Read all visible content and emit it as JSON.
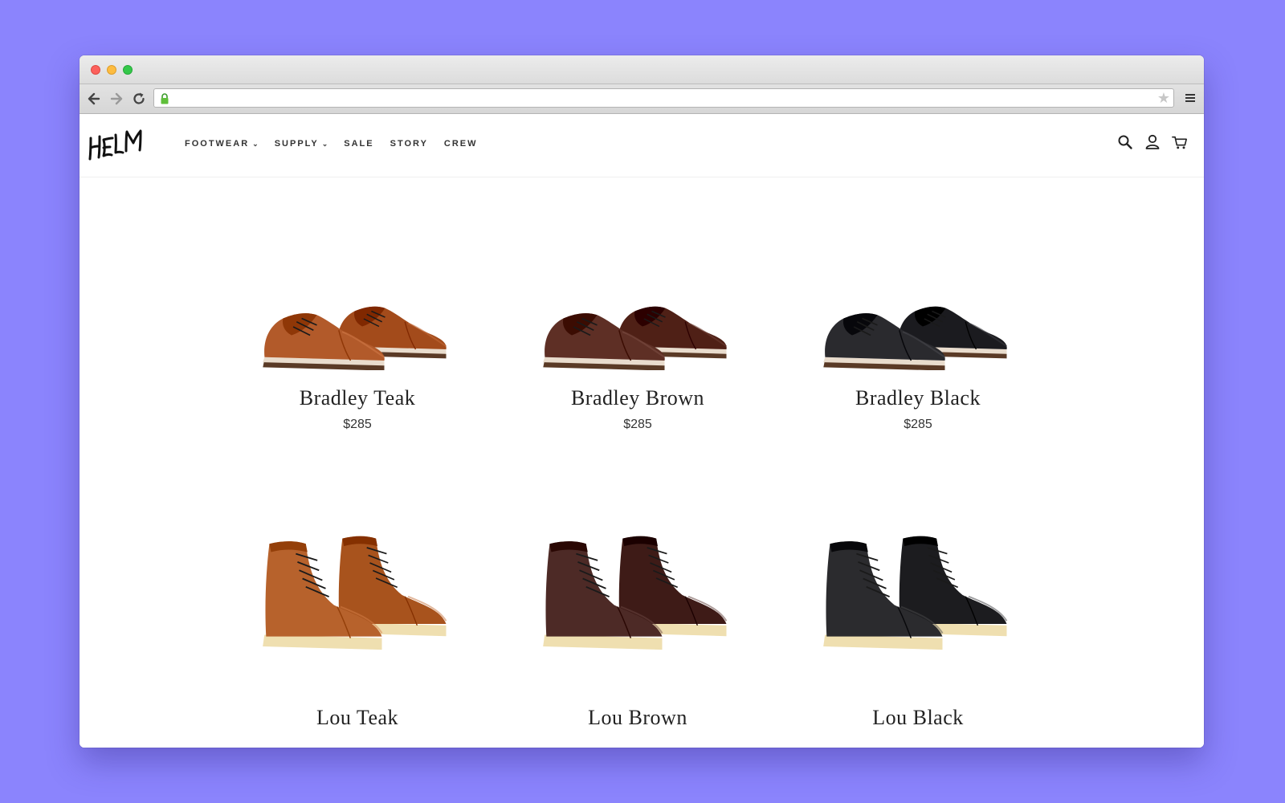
{
  "brand": {
    "logo_text": "HELM"
  },
  "nav": {
    "items": [
      {
        "label": "FOOTWEAR",
        "has_dropdown": true
      },
      {
        "label": "SUPPLY",
        "has_dropdown": true
      },
      {
        "label": "SALE",
        "has_dropdown": false
      },
      {
        "label": "STORY",
        "has_dropdown": false
      },
      {
        "label": "CREW",
        "has_dropdown": false
      }
    ],
    "dropdown_glyph": "⌄"
  },
  "header_icons": [
    "search-icon",
    "account-icon",
    "cart-icon"
  ],
  "products": [
    {
      "name": "Bradley Teak",
      "price": "$285",
      "style": "oxford",
      "color": "#b25a2a"
    },
    {
      "name": "Bradley Brown",
      "price": "$285",
      "style": "oxford",
      "color": "#5e2f25"
    },
    {
      "name": "Bradley Black",
      "price": "$285",
      "style": "oxford",
      "color": "#2a2a2e"
    },
    {
      "name": "Lou Teak",
      "price": "",
      "style": "boot",
      "color": "#b7622c"
    },
    {
      "name": "Lou Brown",
      "price": "",
      "style": "boot",
      "color": "#4d2a26"
    },
    {
      "name": "Lou Black",
      "price": "",
      "style": "boot",
      "color": "#2b2b2e"
    }
  ],
  "colors": {
    "background": "#8b84fd",
    "nav_text": "#333333"
  }
}
